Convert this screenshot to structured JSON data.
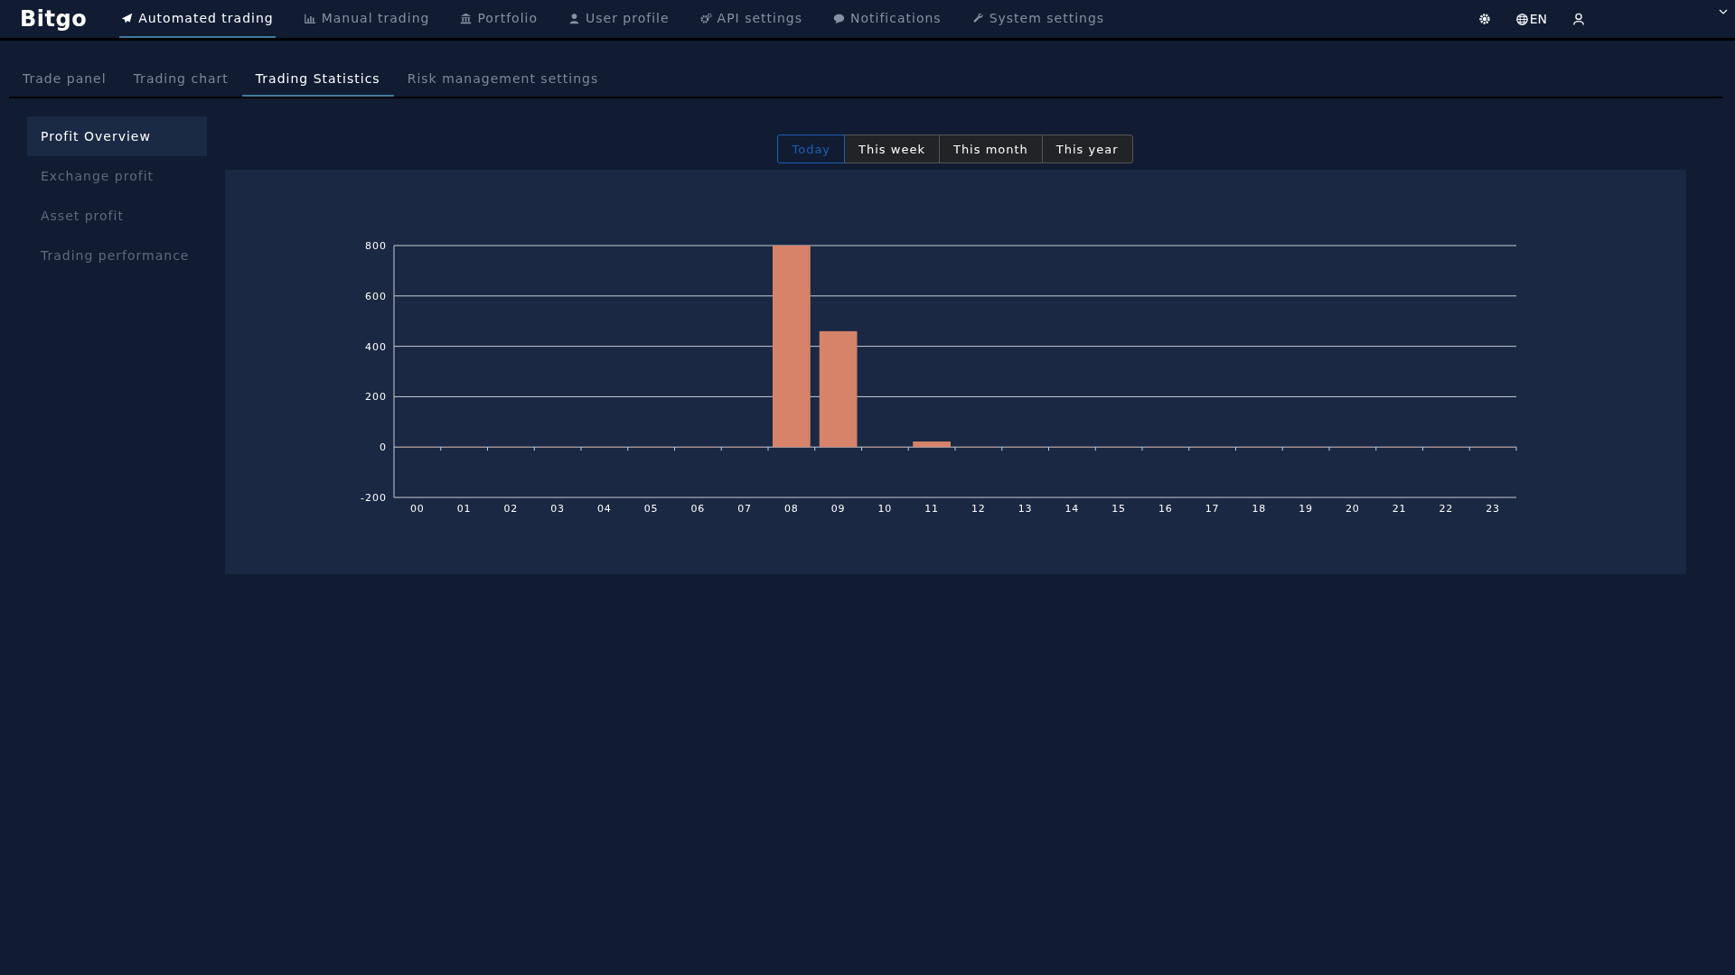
{
  "brand": "Bitgo",
  "nav": [
    {
      "label": "Automated trading",
      "kind": "plane",
      "selected": true
    },
    {
      "label": "Manual trading",
      "kind": "chart",
      "selected": false
    },
    {
      "label": "Portfolio",
      "kind": "bank",
      "selected": false
    },
    {
      "label": "User profile",
      "kind": "user",
      "selected": false
    },
    {
      "label": "API settings",
      "kind": "gears",
      "selected": false
    },
    {
      "label": "Notifications",
      "kind": "bubble",
      "selected": false
    },
    {
      "label": "System settings",
      "kind": "wrench",
      "selected": false
    }
  ],
  "language": "EN",
  "subtabs": [
    {
      "label": "Trade panel",
      "selected": false
    },
    {
      "label": "Trading chart",
      "selected": false
    },
    {
      "label": "Trading Statistics",
      "selected": true
    },
    {
      "label": "Risk management settings",
      "selected": false
    }
  ],
  "sidebar": {
    "items": [
      {
        "label": "Profit Overview",
        "selected": true
      },
      {
        "label": "Exchange profit",
        "selected": false
      },
      {
        "label": "Asset profit",
        "selected": false
      },
      {
        "label": "Trading performance",
        "selected": false
      }
    ]
  },
  "periods": [
    {
      "label": "Today",
      "selected": true
    },
    {
      "label": "This week",
      "selected": false
    },
    {
      "label": "This month",
      "selected": false
    },
    {
      "label": "This year",
      "selected": false
    }
  ],
  "profit_chart": {
    "chart_data": {
      "type": "bar",
      "categories": [
        "00",
        "01",
        "02",
        "03",
        "04",
        "05",
        "06",
        "07",
        "08",
        "09",
        "10",
        "11",
        "12",
        "13",
        "14",
        "15",
        "16",
        "17",
        "18",
        "19",
        "20",
        "21",
        "22",
        "23"
      ],
      "grid": true,
      "series": [
        {
          "color": "#d6836a",
          "values": [
            0,
            0,
            0,
            0,
            0,
            0,
            0,
            0,
            800,
            460,
            0,
            22,
            0,
            0,
            0,
            0,
            0,
            0,
            0,
            0,
            0,
            0,
            0,
            0
          ]
        }
      ],
      "ylim": [
        -200,
        800
      ],
      "yticks": [
        -200,
        0,
        200,
        400,
        600,
        800
      ]
    }
  }
}
